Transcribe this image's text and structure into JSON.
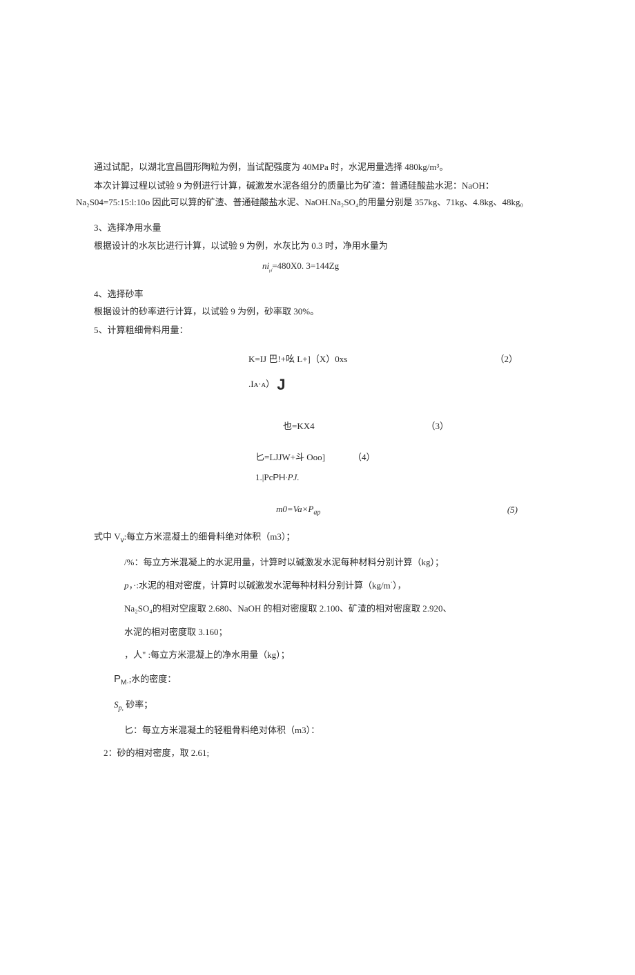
{
  "p1": "通过试配，以湖北宜昌圆形陶粒为例，当试配强度为 40MPa 时，水泥用量选择 480kg/m³。",
  "p2": "本次计算过程以试验 9 为例进行计算，碱激发水泥各组分的质量比为矿渣：普通硅酸盐水泥：NaOH：Na₂S04=75:15:l:10o 因此可以算的矿渣、普通硅酸盐水泥、NaOH.Na₂SO₄的用量分别是 357kg、71kg、4.8kg、48kg₀",
  "h3": "3、选择净用水量",
  "p3": "根据设计的水灰比进行计算，以试验 9 为例，水灰比为 0.3 时，净用水量为",
  "f1": "ni",
  "f1b": "=480X0. 3=144Zg",
  "f1sub": "ᵧⱼ",
  "h4": "4、选择砂率",
  "p4": "根据设计的砂率进行计算，以试验 9 为例，砂率取 30%。",
  "h5": "5、计算粗细骨料用量：",
  "f2a": "K=IJ 巴!+吆 L+]（X）0xs",
  "f2b": ".Iᴀ·ᴀ）",
  "f3": "也=KX4",
  "f4": "匕=LJJW+斗 Ooo]",
  "f4b": "1.|Pc",
  "f4c": "PH",
  "f4d": "·PJ.",
  "f5a": "m0=Va×P",
  "f5sub": "ap",
  "num2": "（2）",
  "num3": "（3）",
  "num4": "（4）",
  "num5": "(5)",
  "defs_intro": "式中 V",
  "defs_intro_sub": "v",
  "defs_intro2": ":每立方米混凝土的细骨料绝对体积（m3）；",
  "d1": "/%：每立方米混凝上的水泥用量，计算时以碱激发水泥每种材料分别计算（kg）；",
  "d2a": "p",
  "d2b": "，·:水泥的相对密度，计算时以碱激发水泥每种材料分别计算（kg/m",
  "d2c": "），",
  "d3": "Na₂SO₄的相对空度取 2.680、NaOH 的相对密度取 2.100、矿渣的相对密度取 2.920、",
  "d4": "水泥的相对密度取 3.160；",
  "d5": "，人\" :每立方米混凝上的净水用量（kg）；",
  "d6a": "P",
  "d6sub": "M·",
  "d6b": ";水的密度：",
  "d7a": "S",
  "d7sub": "p,",
  "d7b": " 砂率；",
  "d8": "匕：每立方米混凝土的轻粗骨料绝对体积（m3）：",
  "d9": "2：砂的相对密度，取 2.61;"
}
